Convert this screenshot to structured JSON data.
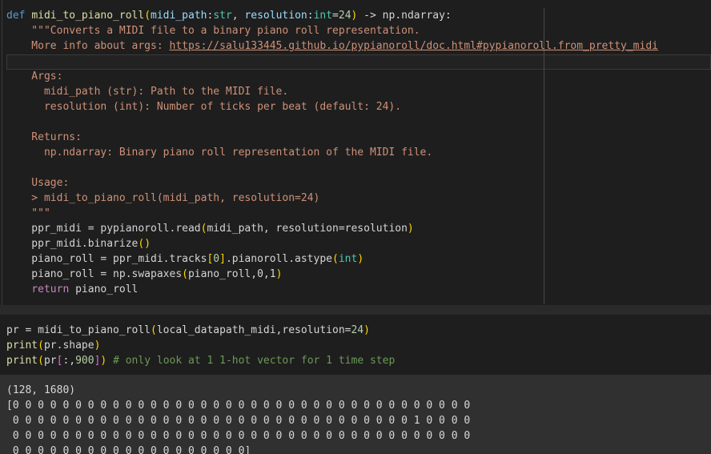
{
  "code_cell": {
    "lines": [
      {
        "parts": [
          "def",
          " ",
          "midi_to_piano_roll",
          "(",
          "midi_path",
          ":",
          "str",
          ", ",
          "resolution",
          ":",
          "int",
          "=",
          "24",
          ")",
          " -> np.ndarray:"
        ]
      },
      {
        "text": "    \"\"\"Converts a MIDI file to a binary piano roll representation."
      },
      {
        "prefix": "    More info about args: ",
        "link": "https://salu133445.github.io/pypianoroll/doc.html#pypianoroll.from_pretty_midi"
      },
      {
        "text": ""
      },
      {
        "text": "    Args:"
      },
      {
        "text": "      midi_path (str): Path to the MIDI file."
      },
      {
        "text": "      resolution (int): Number of ticks per beat (default: 24)."
      },
      {
        "text": ""
      },
      {
        "text": "    Returns:"
      },
      {
        "text": "      np.ndarray: Binary piano roll representation of the MIDI file."
      },
      {
        "text": ""
      },
      {
        "text": "    Usage:"
      },
      {
        "text": "    > midi_to_piano_roll(midi_path, resolution=24)"
      },
      {
        "text": "    \"\"\""
      },
      {
        "parts": [
          "    ppr_midi = pypianoroll.read",
          "(",
          "midi_path, resolution=resolution",
          ")"
        ]
      },
      {
        "parts": [
          "    ppr_midi.binarize",
          "()"
        ]
      },
      {
        "parts": [
          "    piano_roll = ppr_midi.tracks",
          "[",
          "0",
          "]",
          ".pianoroll.astype",
          "(",
          "int",
          ")"
        ]
      },
      {
        "parts": [
          "    piano_roll = np.swapaxes",
          "(",
          "piano_roll,0,1",
          ")"
        ]
      },
      {
        "parts": [
          "    ",
          "return",
          " piano_roll"
        ]
      }
    ]
  },
  "run_cell": {
    "lines": [
      {
        "parts": [
          "pr = midi_to_piano_roll",
          "(",
          "local_datapath_midi,resolution=",
          "24",
          ")"
        ]
      },
      {
        "parts": [
          "print",
          "(",
          "pr.shape",
          ")"
        ]
      },
      {
        "parts": [
          "print",
          "(",
          "pr",
          "[",
          ":,",
          "900",
          "]",
          ")",
          " # only look at 1 1-hot vector for 1 time step"
        ]
      }
    ]
  },
  "output": {
    "lines": [
      "(128, 1680)",
      "[0 0 0 0 0 0 0 0 0 0 0 0 0 0 0 0 0 0 0 0 0 0 0 0 0 0 0 0 0 0 0 0 0 0 0 0 0",
      " 0 0 0 0 0 0 0 0 0 0 0 0 0 0 0 0 0 0 0 0 0 0 0 0 0 0 0 0 0 0 0 0 1 0 0 0 0",
      " 0 0 0 0 0 0 0 0 0 0 0 0 0 0 0 0 0 0 0 0 0 0 0 0 0 0 0 0 0 0 0 0 0 0 0 0 0",
      " 0 0 0 0 0 0 0 0 0 0 0 0 0 0 0 0 0 0 0]"
    ]
  },
  "colors": {
    "editor_bg": "#1e1e1e",
    "output_bg": "#303030",
    "keyword": "#569cd6",
    "function": "#dcdcaa",
    "string": "#ce9178",
    "number": "#b5cea8",
    "comment": "#6a9955",
    "paren": "#ffd700"
  }
}
